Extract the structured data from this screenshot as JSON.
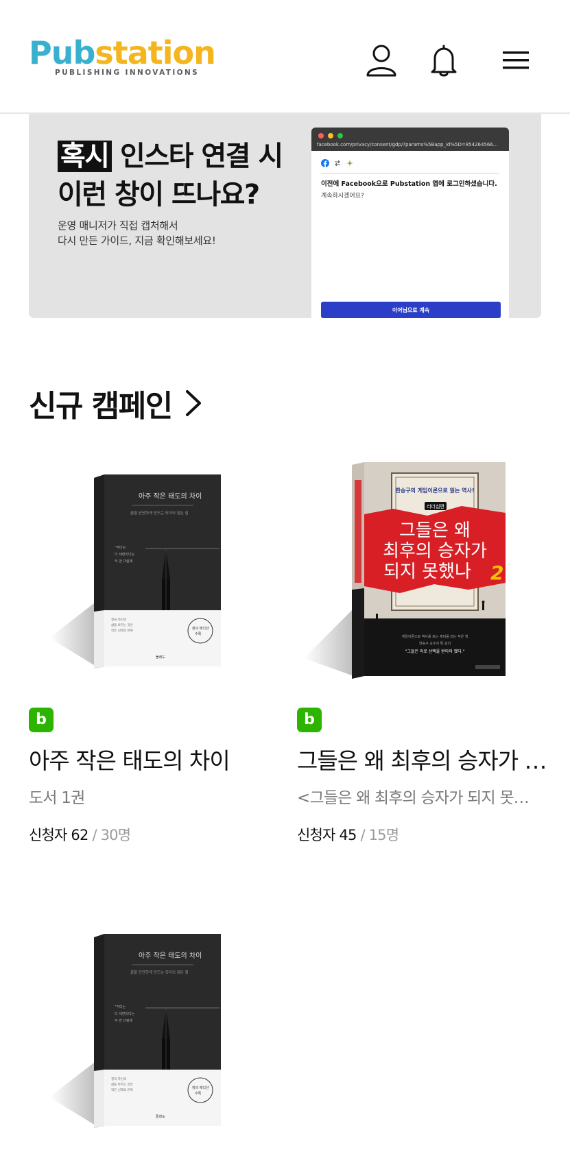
{
  "header": {
    "logo_part1": "Pub",
    "logo_part2": "station",
    "logo_tagline": "PUBLISHING INNOVATIONS",
    "icons": [
      "user-icon",
      "bell-icon",
      "menu-icon"
    ]
  },
  "banner": {
    "title_highlight": "혹시",
    "title_line1_rest": " 인스타 연결 시",
    "title_line2": "이런 창이 뜨나요?",
    "subtitle_line1": "운영 매니저가 직접 캡처해서",
    "subtitle_line2": "다시 만든 가이드, 지금 확인해보세요!",
    "mock_url": "facebook.com/privacy/consent/gdp/?params%5Bapp_id%5D=854264566...",
    "mock_heading": "이전에 Facebook으로 Pubstation 앱에 로그인하셨습니다.",
    "mock_text": "계속하시겠어요?",
    "mock_button": "이어님으로 계속"
  },
  "section": {
    "title": "신규 캠페인"
  },
  "campaigns": [
    {
      "badge": "b",
      "title": "아주 작은 태도의 차이",
      "desc": "도서 1권",
      "applicants": "신청자 62",
      "quota": " / 30명",
      "cover_title": "아주 작은 태도의 차이",
      "cover_sub": "끝을 단단하게 만드는 되더의 잠든 힘",
      "cover_author": "돌레도"
    },
    {
      "badge": "b",
      "title": "그들은 왜 최후의 승자가 …",
      "desc": "<그들은 왜 최후의 승자가 되지 못…",
      "applicants": "신청자 45",
      "quota": " / 15명",
      "cover_top": "한승구의 게임이론으로 읽는 역사!",
      "cover_tag": "리더십편",
      "cover_line1": "그들은 왜",
      "cover_line2": "최후의 승자가",
      "cover_line3": "되지 못했나",
      "cover_num": "2",
      "cover_bottom": "\"그들은 의로 선택을 받아의 했다.\""
    },
    {
      "cover_title": "아주 작은 태도의 차이",
      "cover_sub": "끝을 단단하게 만드는 되더의 잠든 힘",
      "cover_author": "돌레도"
    }
  ],
  "colors": {
    "logo_blue": "#3ab0cf",
    "logo_yellow": "#f4b51e",
    "badge_green": "#2db400",
    "banner_bg": "#e3e3e3",
    "cta_blue": "#2a3ec8",
    "book2_red": "#d81f26"
  }
}
